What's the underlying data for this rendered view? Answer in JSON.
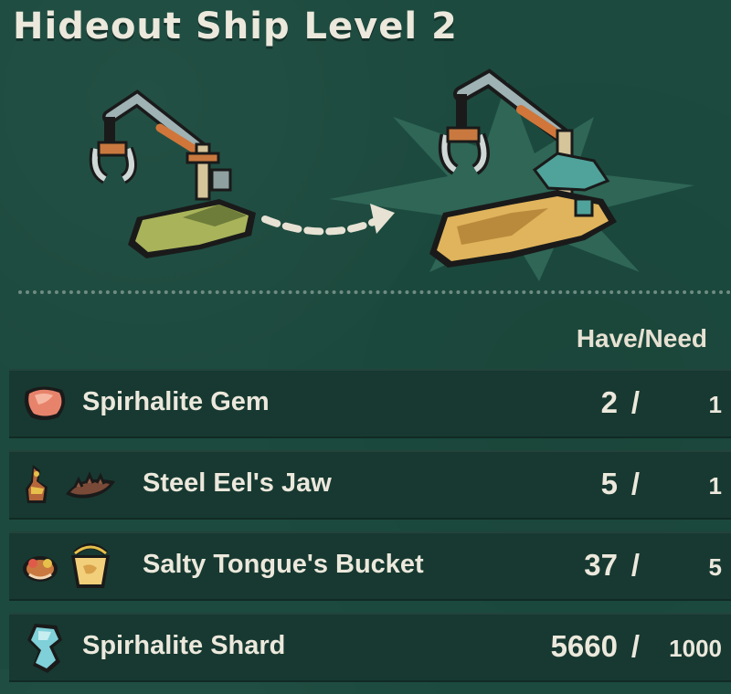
{
  "title": "Hideout Ship Level 2",
  "column_header": "Have/Need",
  "upgrade_art": {
    "from_icon": "small-crane-ship-icon",
    "arrow_icon": "dashed-arrow-icon",
    "to_icon": "large-crane-ship-icon"
  },
  "materials": [
    {
      "name": "Spirhalite Gem",
      "have": "2",
      "slash": "/",
      "need": "1",
      "icons": [
        "spirhalite-gem-icon"
      ]
    },
    {
      "name": "Steel Eel's Jaw",
      "have": "5",
      "slash": "/",
      "need": "1",
      "icons": [
        "steel-eel-enemy-icon",
        "eel-jaw-icon"
      ]
    },
    {
      "name": "Salty Tongue's Bucket",
      "have": "37",
      "slash": "/",
      "need": "5",
      "icons": [
        "salty-tongue-enemy-icon",
        "bucket-icon"
      ]
    },
    {
      "name": "Spirhalite Shard",
      "have": "5660",
      "slash": "/",
      "need": "1000",
      "icons": [
        "spirhalite-shard-icon"
      ]
    }
  ],
  "colors": {
    "background": "#1c4a3e",
    "row_background": "#173931",
    "text": "#ece8dc"
  }
}
